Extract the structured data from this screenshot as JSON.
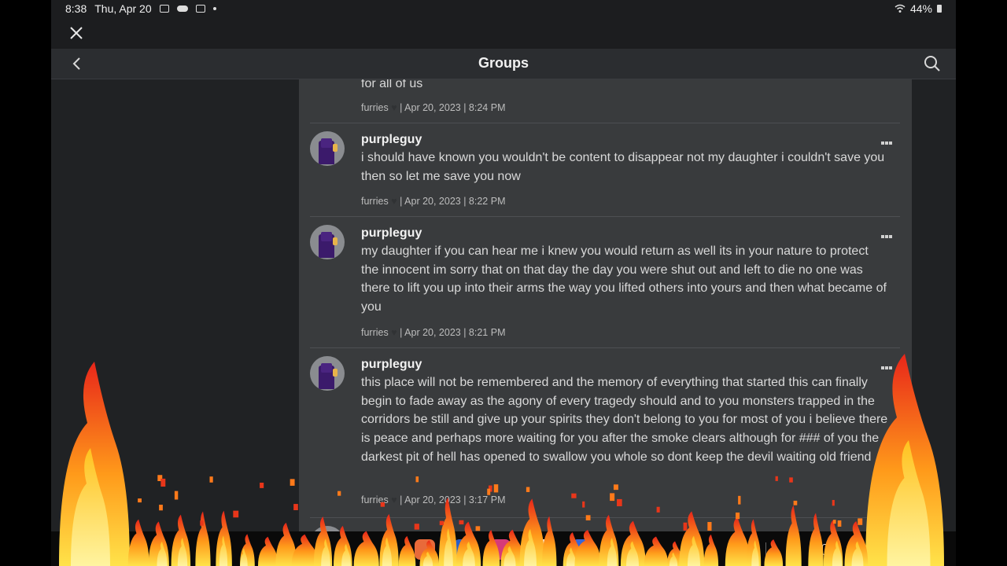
{
  "status_bar": {
    "time": "8:38",
    "date": "Thu, Apr 20",
    "battery": "44%",
    "icons": [
      "screenshot-icon",
      "cloud-icon",
      "calendar-icon",
      "notification-dot-icon",
      "wifi-icon",
      "battery-icon"
    ]
  },
  "header": {
    "title": "Groups",
    "icons": [
      "close-icon",
      "back-chevron-icon",
      "search-icon"
    ]
  },
  "posts": [
    {
      "author": "",
      "text": "for all of us",
      "group": "furries",
      "date": "| Apr 20, 2023 | 8:24 PM"
    },
    {
      "author": "purpleguy",
      "text": "i should have known you wouldn't be content to disappear not my daughter i couldn't save you then so let me save you now",
      "group": "furries",
      "date": "| Apr 20, 2023 | 8:22 PM"
    },
    {
      "author": "purpleguy",
      "text": "my daughter if you can hear me i knew you would return as well its in your nature to protect the innocent im sorry that on that day the day you were shut out and left to die no one was there to lift you up into their arms the way you lifted others into yours and then what became of you",
      "group": "furries",
      "date": "| Apr 20, 2023 | 8:21 PM"
    },
    {
      "author": "purpleguy",
      "text": "this place will not be remembered and the memory of everything that started this can finally begin to fade away as the agony of every tragedy should and to you monsters trapped in the corridors be still and give up your spirits they don't belong to you for most of you i believe there is peace and perhaps more waiting for you after the smoke clears although for ### of you the darkest pit of hell has opened to swallow you whole so dont keep the devil waiting old friend",
      "group": "furries",
      "date": "| Apr 20, 2023 | 3:17 PM"
    }
  ],
  "dock": {
    "apps": [
      "photos-app-icon",
      "files-app-icon",
      "browser-app-icon",
      "youtube-app-icon",
      "video-editor-app-icon"
    ]
  },
  "colors": {
    "background": "#202224",
    "panel": "#393b3d",
    "header": "#2b2d30",
    "text": "#d9d9d9",
    "fire_red": "#e8361a",
    "fire_yellow": "#ffd21f"
  }
}
